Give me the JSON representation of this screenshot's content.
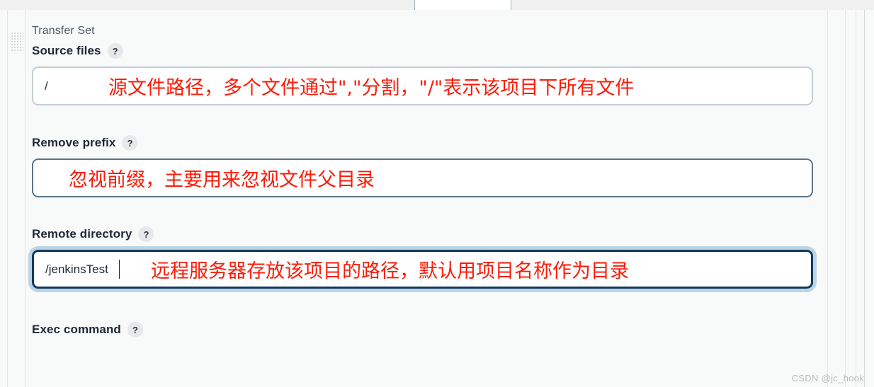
{
  "window": {
    "tab_active": true
  },
  "section": {
    "title": "Transfer Set"
  },
  "watermark": {
    "text": "CSDN @jc_hook"
  },
  "help_glyph": "?",
  "fields": [
    {
      "label": "Source files",
      "help": "?",
      "value": "/",
      "placeholder": "",
      "state": "default",
      "annotation": "源文件路径，多个文件通过\",\"分割，\"/\"表示该项目下所有文件"
    },
    {
      "label": "Remove prefix",
      "help": "?",
      "value": "",
      "placeholder": "",
      "state": "hover",
      "annotation": "忽视前缀，主要用来忽视文件父目录"
    },
    {
      "label": "Remote directory",
      "help": "?",
      "value": "/jenkinsTest",
      "placeholder": "",
      "state": "focus",
      "annotation": "远程服务器存放该项目的路径，默认用项目名称作为目录"
    }
  ],
  "footer_field": {
    "label": "Exec command",
    "help": "?"
  },
  "colors": {
    "annotation_red": "#fb1b08",
    "focus_border": "#103a5c",
    "focus_halo": "#bcd4e4",
    "hover_border": "#5d7486",
    "default_border": "#c3cdd4",
    "panel_bg": "#f8f9f9",
    "label_dark": "#1f2937",
    "section_gray": "#4e5a63"
  }
}
